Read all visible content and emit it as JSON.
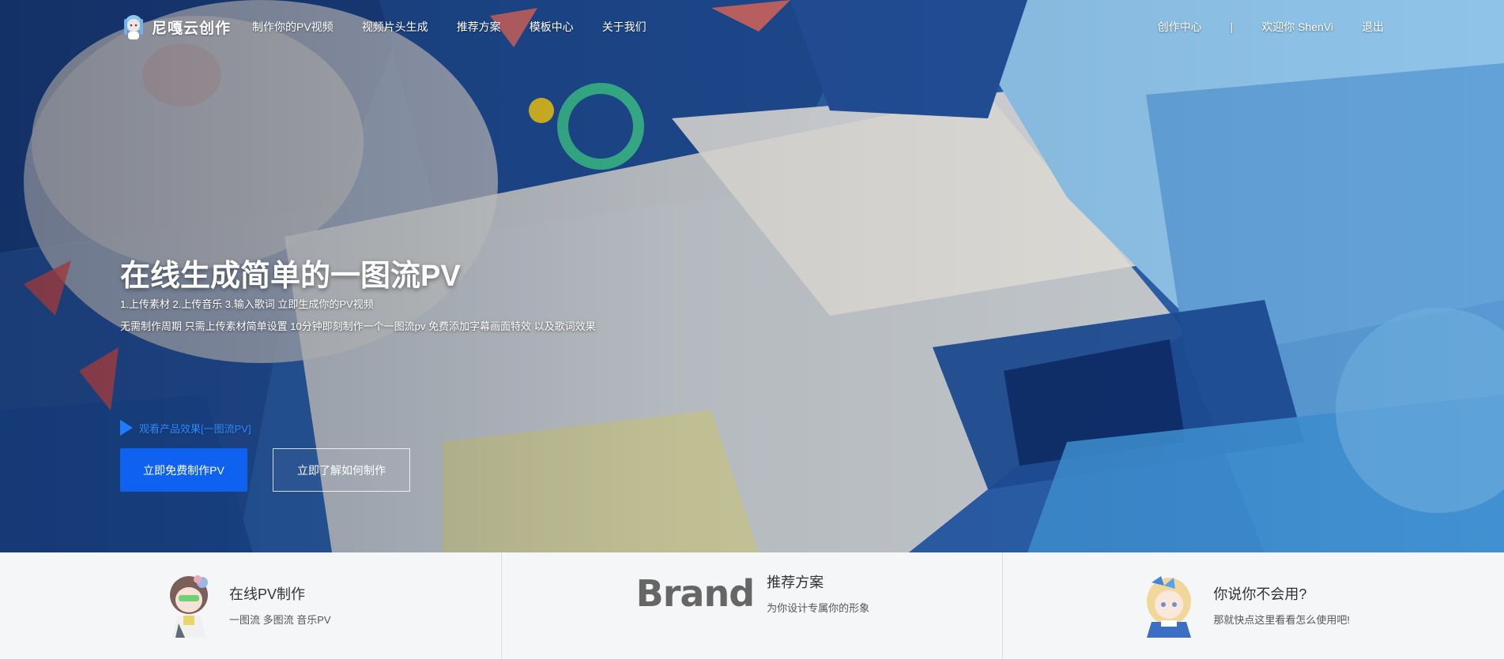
{
  "nav": {
    "logo_text": "尼嘎云创作",
    "links": [
      "制作你的PV视频",
      "视频片头生成",
      "推荐方案",
      "模板中心",
      "关于我们"
    ],
    "creator_center": "创作中心",
    "separator": "|",
    "welcome": "欢迎你 ShenVi",
    "logout": "退出"
  },
  "hero": {
    "title": "在线生成简单的一图流PV",
    "steps": "1.上传素材 2.上传音乐 3.输入歌词 立即生成你的PV视频",
    "description": "无需制作周期 只需上传素材简单设置 10分钟即刻制作一个一图流pv 免费添加字幕画面特效 以及歌词效果",
    "watch_link": "观看产品效果[一图流PV]",
    "primary_button": "立即免费制作PV",
    "secondary_button": "立即了解如何制作"
  },
  "features": [
    {
      "title": "在线PV制作",
      "desc": "一图流 多图流 音乐PV",
      "icon": "chibi-girl-avatar-icon"
    },
    {
      "title": "推荐方案",
      "desc": "为你设计专属你的形象",
      "logo_text": "Brand"
    },
    {
      "title": "你说你不会用?",
      "desc": "那就快点这里看看怎么使用吧!",
      "icon": "blonde-girl-avatar-icon"
    }
  ],
  "colors": {
    "primary": "#0f62f0",
    "link": "#2a8cff",
    "strip_bg": "#f5f6f8"
  }
}
